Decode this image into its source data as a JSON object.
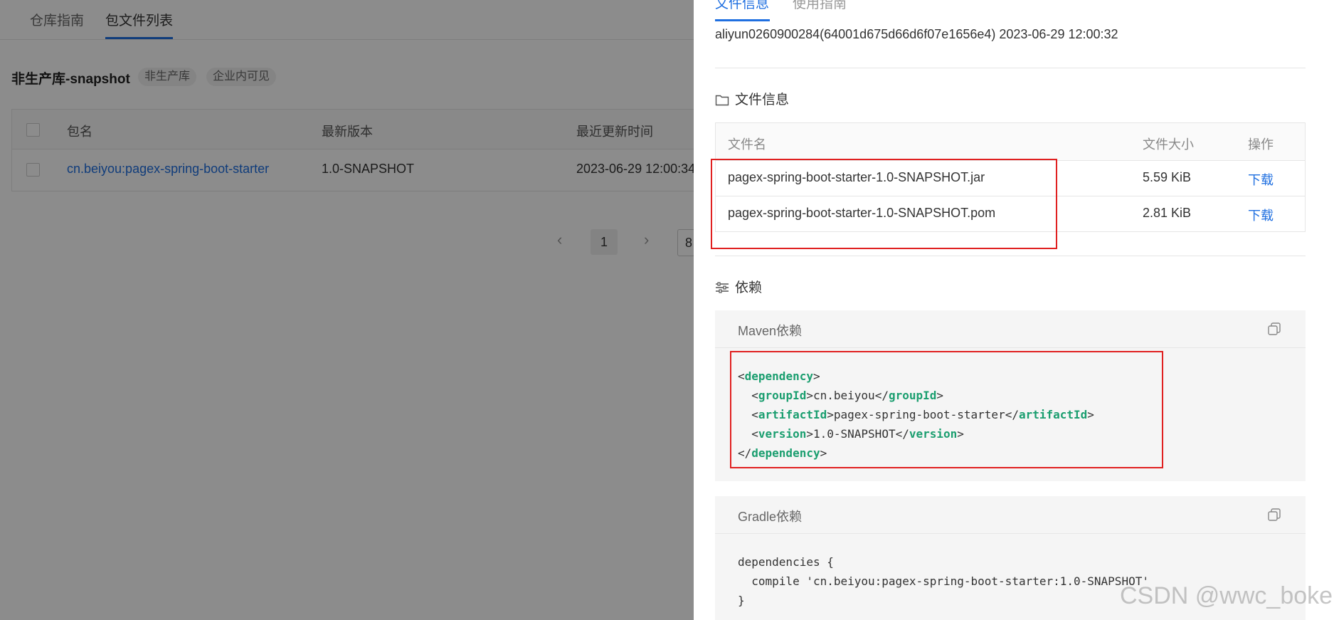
{
  "left_page": {
    "tabs": [
      "仓库指南",
      "包文件列表"
    ],
    "repo_title": "非生产库-snapshot",
    "tags": [
      "非生产库",
      "企业内可见"
    ],
    "table": {
      "headers": [
        "包名",
        "最新版本",
        "最近更新时间"
      ],
      "rows": [
        {
          "name": "cn.beiyou:pagex-spring-boot-starter",
          "version": "1.0-SNAPSHOT",
          "updated": "2023-06-29 12:00:34"
        }
      ]
    },
    "pagination": {
      "prev": "‹",
      "current": "1",
      "next": "›",
      "page_size": "8"
    }
  },
  "drawer": {
    "tabs": [
      "文件信息",
      "使用指南"
    ],
    "meta": "aliyun0260900284(64001d675d66d6f07e1656e4)  2023-06-29 12:00:32",
    "files_section": {
      "title": "文件信息",
      "headers": [
        "文件名",
        "文件大小",
        "操作"
      ],
      "rows": [
        {
          "name": "pagex-spring-boot-starter-1.0-SNAPSHOT.jar",
          "size": "5.59 KiB",
          "action": "下载"
        },
        {
          "name": "pagex-spring-boot-starter-1.0-SNAPSHOT.pom",
          "size": "2.81 KiB",
          "action": "下载"
        }
      ]
    },
    "deps_section": {
      "title": "依赖",
      "maven": {
        "label": "Maven依赖",
        "lines": [
          {
            "indent": "",
            "tag": "dependency",
            "text": "",
            "closing": false
          },
          {
            "indent": "  ",
            "tag": "groupId",
            "text": "cn.beiyou"
          },
          {
            "indent": "  ",
            "tag": "artifactId",
            "text": "pagex-spring-boot-starter"
          },
          {
            "indent": "  ",
            "tag": "version",
            "text": "1.0-SNAPSHOT"
          },
          {
            "indent": "",
            "tag": "dependency",
            "text": "",
            "closing": true
          }
        ]
      },
      "gradle": {
        "label": "Gradle依赖",
        "code": "dependencies {\n  compile 'cn.beiyou:pagex-spring-boot-starter:1.0-SNAPSHOT'\n}"
      }
    }
  },
  "watermark": "CSDN @wwc_boke",
  "colors": {
    "accent": "#1f6fe0",
    "highlight_box": "#e02020",
    "xml_tag": "#1a9e6f"
  }
}
